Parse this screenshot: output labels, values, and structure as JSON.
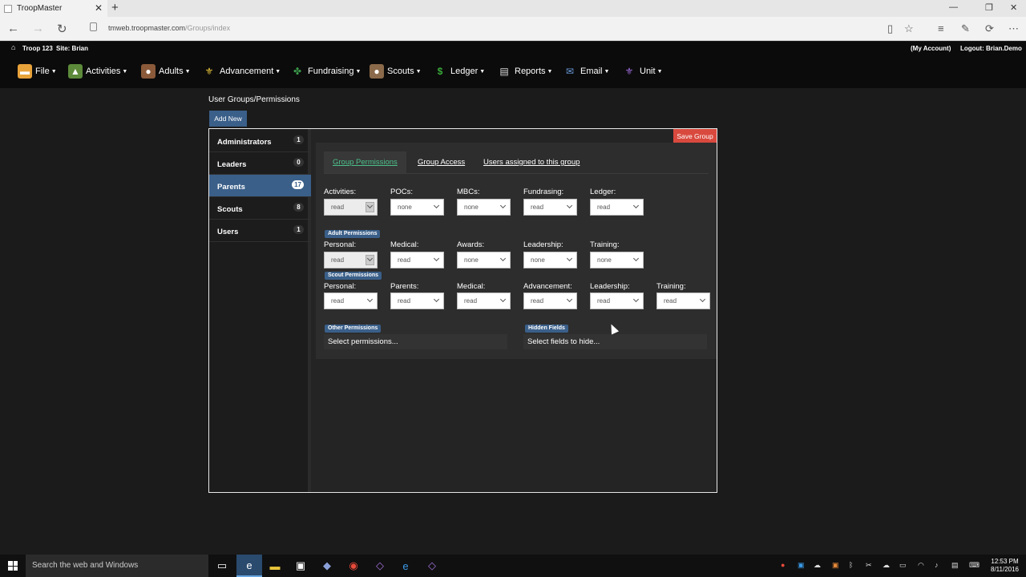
{
  "browser": {
    "tab_title": "TroopMaster",
    "url_host": "tmweb.troopmaster.com",
    "url_path": "/Groups/index"
  },
  "site_header": {
    "troop": "Troop 123",
    "site": "Site: Brian",
    "my_account": "(My Account)",
    "logout": "Logout: Brian.Demo"
  },
  "menu": [
    {
      "label": "File",
      "icon": "folder-icon",
      "color": "#e8a23a"
    },
    {
      "label": "Activities",
      "icon": "activities-icon",
      "color": "#5c8a3a"
    },
    {
      "label": "Adults",
      "icon": "adult-icon",
      "color": "#8a5a3a"
    },
    {
      "label": "Advancement",
      "icon": "fleur-de-lis-icon",
      "color": "#e8c53a"
    },
    {
      "label": "Fundraising",
      "icon": "fundraising-icon",
      "color": "#3a9a4a"
    },
    {
      "label": "Scouts",
      "icon": "scout-icon",
      "color": "#8a6a4a"
    },
    {
      "label": "Ledger",
      "icon": "dollar-icon",
      "color": "#3aaa3a"
    },
    {
      "label": "Reports",
      "icon": "report-icon",
      "color": "#dddddd"
    },
    {
      "label": "Email",
      "icon": "email-icon",
      "color": "#6a9ad8"
    },
    {
      "label": "Unit",
      "icon": "unit-icon",
      "color": "#9a6ad8"
    }
  ],
  "page": {
    "title": "User Groups/Permissions",
    "add_new": "Add New",
    "save_group": "Save Group"
  },
  "groups": [
    {
      "label": "Administrators",
      "count": "1",
      "active": false
    },
    {
      "label": "Leaders",
      "count": "0",
      "active": false
    },
    {
      "label": "Parents",
      "count": "17",
      "active": true
    },
    {
      "label": "Scouts",
      "count": "8",
      "active": false
    },
    {
      "label": "Users",
      "count": "1",
      "active": false
    }
  ],
  "tabs": [
    {
      "label": "Group Permissions",
      "active": true
    },
    {
      "label": "Group Access",
      "active": false
    },
    {
      "label": "Users assigned to this group",
      "active": false
    }
  ],
  "general_permissions": [
    {
      "label": "Activities:",
      "value": "read",
      "disabled": true
    },
    {
      "label": "POCs:",
      "value": "none",
      "disabled": false
    },
    {
      "label": "MBCs:",
      "value": "none",
      "disabled": false
    },
    {
      "label": "Fundrasing:",
      "value": "read",
      "disabled": false
    },
    {
      "label": "Ledger:",
      "value": "read",
      "disabled": false
    }
  ],
  "adult_permissions": {
    "badge": "Adult Permissions",
    "fields": [
      {
        "label": "Personal:",
        "value": "read",
        "disabled": true
      },
      {
        "label": "Medical:",
        "value": "read",
        "disabled": false
      },
      {
        "label": "Awards:",
        "value": "none",
        "disabled": false
      },
      {
        "label": "Leadership:",
        "value": "none",
        "disabled": false
      },
      {
        "label": "Training:",
        "value": "none",
        "disabled": false
      }
    ]
  },
  "scout_permissions": {
    "badge": "Scout Permissions",
    "fields": [
      {
        "label": "Personal:",
        "value": "read",
        "disabled": false
      },
      {
        "label": "Parents:",
        "value": "read",
        "disabled": false
      },
      {
        "label": "Medical:",
        "value": "read",
        "disabled": false
      },
      {
        "label": "Advancement:",
        "value": "read",
        "disabled": false
      },
      {
        "label": "Leadership:",
        "value": "read",
        "disabled": false
      },
      {
        "label": "Training:",
        "value": "read",
        "disabled": false
      }
    ]
  },
  "other_permissions": {
    "badge": "Other Permissions",
    "placeholder": "Select permissions..."
  },
  "hidden_fields": {
    "badge": "Hidden Fields",
    "placeholder": "Select fields to hide..."
  },
  "taskbar": {
    "search_placeholder": "Search the web and Windows",
    "time": "12:53 PM",
    "date": "8/11/2016"
  }
}
